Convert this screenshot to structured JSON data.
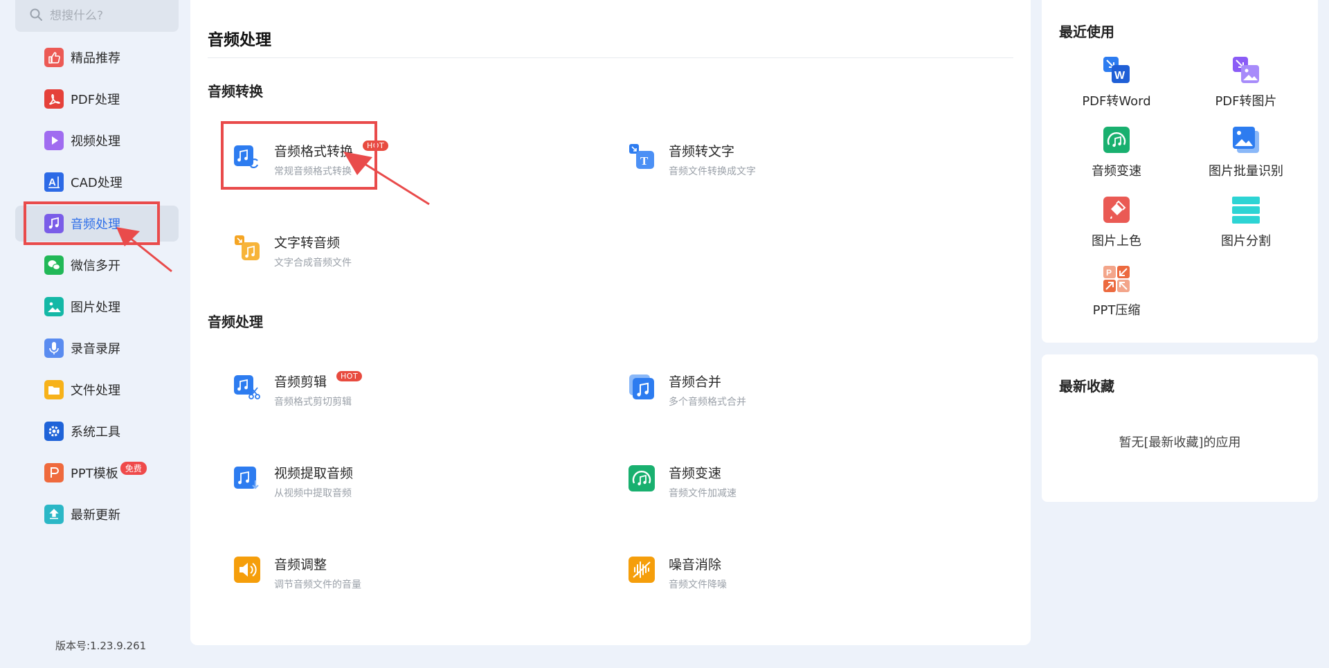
{
  "search": {
    "placeholder": "想搜什么?"
  },
  "sidebar": {
    "items": [
      {
        "label": "精品推荐",
        "icon": "thumbs-up-icon"
      },
      {
        "label": "PDF处理",
        "icon": "pdf-icon"
      },
      {
        "label": "视频处理",
        "icon": "video-play-icon"
      },
      {
        "label": "CAD处理",
        "icon": "cad-icon"
      },
      {
        "label": "音频处理",
        "icon": "music-note-icon",
        "active": true
      },
      {
        "label": "微信多开",
        "icon": "wechat-icon"
      },
      {
        "label": "图片处理",
        "icon": "image-icon"
      },
      {
        "label": "录音录屏",
        "icon": "microphone-icon"
      },
      {
        "label": "文件处理",
        "icon": "folder-icon"
      },
      {
        "label": "系统工具",
        "icon": "gear-icon"
      },
      {
        "label": "PPT模板",
        "icon": "ppt-icon",
        "badge": "免费"
      },
      {
        "label": "最新更新",
        "icon": "upload-icon"
      }
    ],
    "version": "版本号:1.23.9.261"
  },
  "main": {
    "title": "音频处理",
    "sections": [
      {
        "title": "音频转换",
        "tools": [
          {
            "name": "音频格式转换",
            "desc": "常规音频格式转换",
            "hot": "HOT",
            "icon": "audio-convert-icon"
          },
          {
            "name": "音频转文字",
            "desc": "音频文件转换成文字",
            "icon": "audio-to-text-icon"
          },
          {
            "name": "文字转音频",
            "desc": "文字合成音频文件",
            "icon": "text-to-audio-icon"
          }
        ]
      },
      {
        "title": "音频处理",
        "tools": [
          {
            "name": "音频剪辑",
            "desc": "音频格式剪切剪辑",
            "hot": "HOT",
            "icon": "audio-cut-icon"
          },
          {
            "name": "音频合并",
            "desc": "多个音频格式合并",
            "icon": "audio-merge-icon"
          },
          {
            "name": "视频提取音频",
            "desc": "从视频中提取音频",
            "icon": "video-extract-audio-icon"
          },
          {
            "name": "音频变速",
            "desc": "音频文件加减速",
            "icon": "audio-speed-icon"
          },
          {
            "name": "音频调整",
            "desc": "调节音频文件的音量",
            "icon": "volume-icon"
          },
          {
            "name": "噪音消除",
            "desc": "音频文件降噪",
            "icon": "noise-reduce-icon"
          }
        ]
      }
    ]
  },
  "recent": {
    "title": "最近使用",
    "items": [
      {
        "label": "PDF转Word",
        "icon": "pdf-to-word-icon"
      },
      {
        "label": "PDF转图片",
        "icon": "pdf-to-image-icon"
      },
      {
        "label": "音频变速",
        "icon": "audio-speed-icon"
      },
      {
        "label": "图片批量识别",
        "icon": "image-batch-ocr-icon"
      },
      {
        "label": "图片上色",
        "icon": "image-colorize-icon"
      },
      {
        "label": "图片分割",
        "icon": "image-split-icon"
      },
      {
        "label": "PPT压缩",
        "icon": "ppt-compress-icon"
      }
    ]
  },
  "favorites": {
    "title": "最新收藏",
    "empty": "暂无[最新收藏]的应用"
  },
  "colors": {
    "accent": "#2f6fe8",
    "highlight": "#e94b4b",
    "hot_badge": "#e84b3f",
    "background": "#edf2fa"
  }
}
